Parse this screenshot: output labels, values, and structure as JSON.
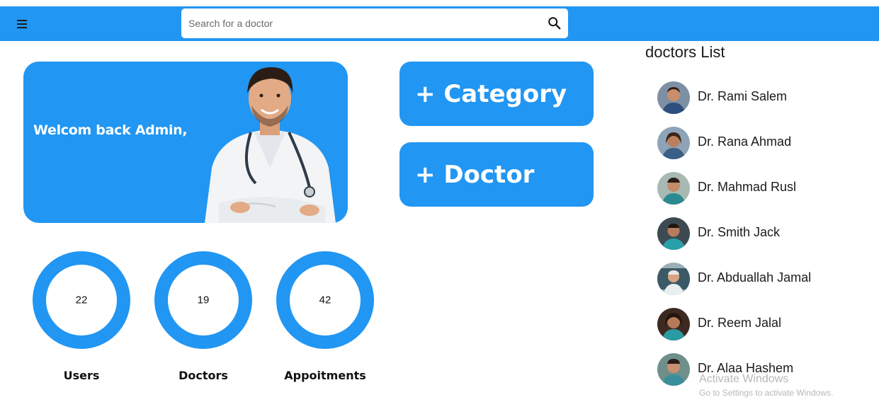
{
  "colors": {
    "primary": "#2196F3",
    "background": "#ffffff"
  },
  "appbar": {
    "menu_icon": "hamburger-menu-icon",
    "search": {
      "placeholder": "Search for a doctor",
      "value": "",
      "icon": "search-icon"
    }
  },
  "welcome": {
    "text": "Welcom back Admin,",
    "image": "doctor-illustration"
  },
  "actions": {
    "category": "+ Category",
    "doctor": "+ Doctor"
  },
  "stats": [
    {
      "label": "Users",
      "value": "22"
    },
    {
      "label": "Doctors",
      "value": "19"
    },
    {
      "label": "Appoitments",
      "value": "42"
    }
  ],
  "doctors_list": {
    "title": "doctors List",
    "items": [
      {
        "name": "Dr. Rami Salem"
      },
      {
        "name": "Dr. Rana Ahmad"
      },
      {
        "name": "Dr. Mahmad Rusl"
      },
      {
        "name": "Dr. Smith Jack"
      },
      {
        "name": "Dr. Abduallah Jamal"
      },
      {
        "name": "Dr. Reem Jalal"
      },
      {
        "name": "Dr. Alaa Hashem"
      }
    ]
  },
  "watermark": {
    "title": "Activate Windows",
    "subtitle": "Go to Settings to activate Windows."
  }
}
